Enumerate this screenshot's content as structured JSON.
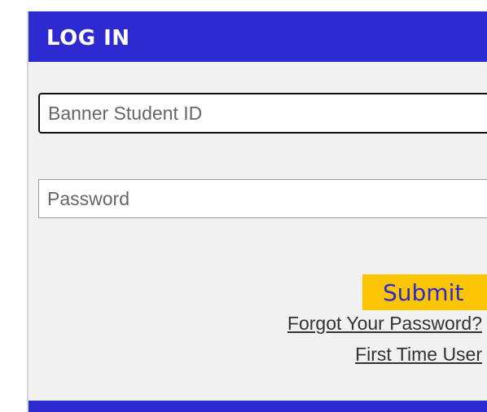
{
  "header": {
    "title": "LOG IN"
  },
  "form": {
    "student_id_placeholder": "Banner Student ID",
    "student_id_value": "",
    "password_placeholder": "Password",
    "password_value": "",
    "submit_label": "Submit"
  },
  "links": {
    "forgot_password": "Forgot Your Password?",
    "first_time_user": "First Time User"
  },
  "colors": {
    "header_bg": "#2d2ad0",
    "panel_bg": "#f1f1f1",
    "submit_bg": "#fdc500",
    "submit_text": "#2d2ad0"
  }
}
